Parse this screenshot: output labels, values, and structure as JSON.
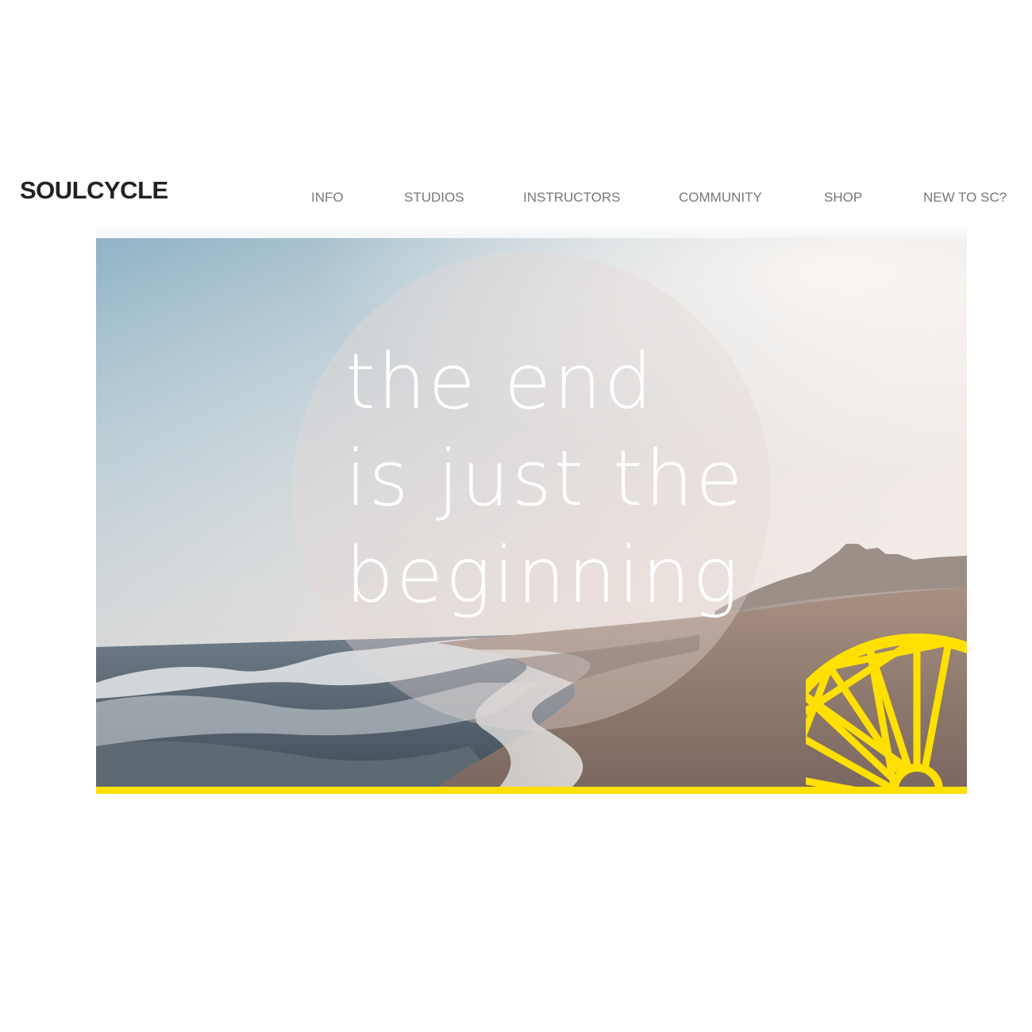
{
  "brand": {
    "logo_text": "SOULCYCLE",
    "accent_color": "#ffe000"
  },
  "nav": {
    "items": [
      {
        "label": "INFO"
      },
      {
        "label": "STUDIOS"
      },
      {
        "label": "INSTRUCTORS"
      },
      {
        "label": "COMMUNITY"
      },
      {
        "label": "SHOP"
      },
      {
        "label": "NEW TO SC?"
      }
    ]
  },
  "hero": {
    "tagline_lines": [
      "the end",
      "is just the",
      "beginning"
    ],
    "image_subject": "beach-shoreline-photo",
    "icon": "bike-wheel-icon"
  }
}
